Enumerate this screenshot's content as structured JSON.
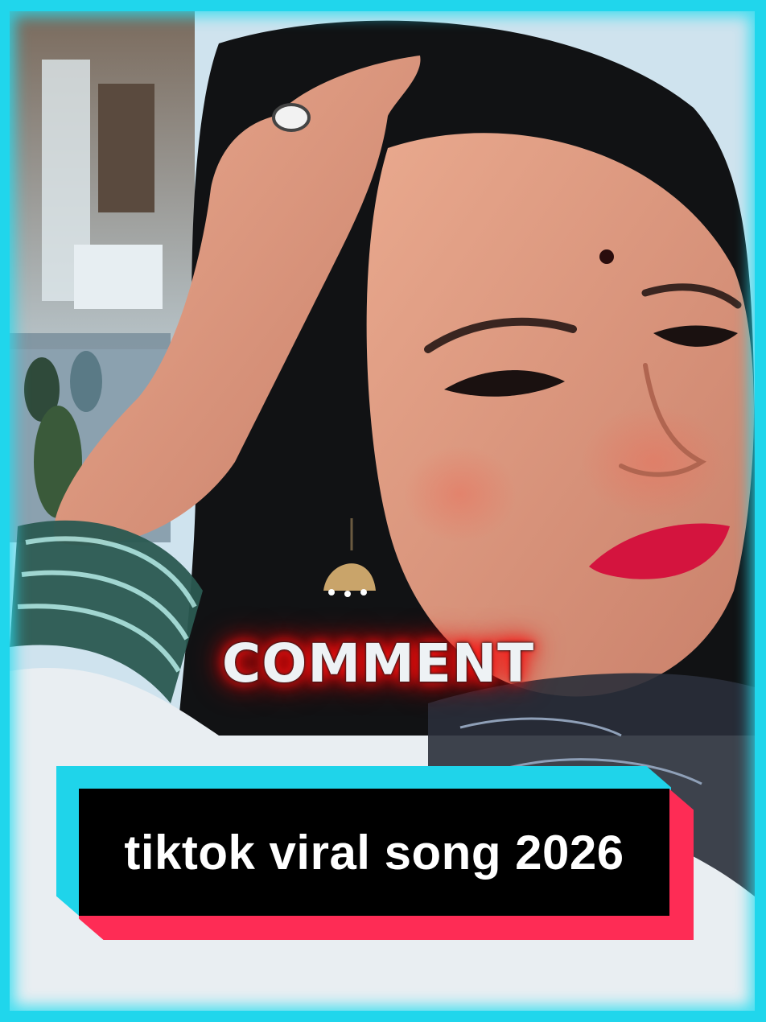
{
  "overlay": {
    "comment_label": "COMMENT",
    "caption": "tiktok viral song 2026"
  },
  "colors": {
    "frame_border": "#1fd4ea",
    "caption_cyan": "#1fd4ea",
    "caption_red": "#fe2c55",
    "caption_bg": "#000000",
    "comment_glow": "#ff1a1a"
  }
}
